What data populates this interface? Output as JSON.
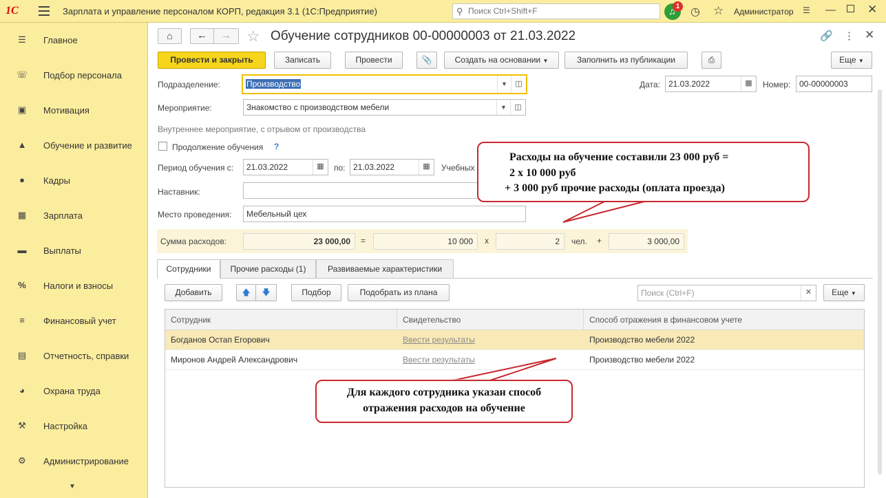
{
  "topbar": {
    "logo": "1С",
    "app_title": "Зарплата и управление персоналом КОРП, редакция 3.1  (1С:Предприятие)",
    "search_placeholder": "Поиск Ctrl+Shift+F",
    "notifications_count": "1",
    "user": "Администратор"
  },
  "sidebar": {
    "items": [
      {
        "label": "Главное",
        "icon": "menu-lines-icon"
      },
      {
        "label": "Подбор персонала",
        "icon": "phone-icon"
      },
      {
        "label": "Мотивация",
        "icon": "gift-icon"
      },
      {
        "label": "Обучение и развитие",
        "icon": "graduation-cap-icon"
      },
      {
        "label": "Кадры",
        "icon": "people-icon"
      },
      {
        "label": "Зарплата",
        "icon": "calculator-icon"
      },
      {
        "label": "Выплаты",
        "icon": "wallet-icon"
      },
      {
        "label": "Налоги и взносы",
        "icon": "percent-icon"
      },
      {
        "label": "Финансовый учет",
        "icon": "ledger-icon"
      },
      {
        "label": "Отчетность, справки",
        "icon": "reports-icon"
      },
      {
        "label": "Охрана труда",
        "icon": "helmet-icon"
      },
      {
        "label": "Настройка",
        "icon": "wrench-icon"
      },
      {
        "label": "Администрирование",
        "icon": "gear-icon"
      }
    ]
  },
  "document": {
    "title": "Обучение сотрудников 00-00000003 от 21.03.2022",
    "toolbar": {
      "post_close": "Провести и закрыть",
      "save": "Записать",
      "post": "Провести",
      "create_based": "Создать на основании",
      "fill_pub": "Заполнить из публикации",
      "more": "Еще"
    },
    "department_label": "Подразделение:",
    "department": "Производство",
    "event_label": "Мероприятие:",
    "event": "Знакомство с производством мебели",
    "event_note": "Внутреннее мероприятие, с отрывом от производства",
    "date_label": "Дата:",
    "date": "21.03.2022",
    "number_label": "Номер:",
    "number": "00-00000003",
    "continue_label": "Продолжение обучения",
    "help": "?",
    "period_label": "Период обучения с:",
    "period_from": "21.03.2022",
    "period_to_label": "по:",
    "period_to": "21.03.2022",
    "study_label": "Учебных",
    "mentor_label": "Наставник:",
    "mentor": "",
    "place_label": "Место проведения:",
    "place": "Мебельный цех",
    "sum_label": "Сумма расходов:",
    "sum_total": "23 000,00",
    "eq": "=",
    "per_person": "10 000",
    "times": "x",
    "persons": "2",
    "persons_unit": "чел.",
    "plus": "+",
    "other": "3 000,00"
  },
  "tabs": [
    {
      "label": "Сотрудники"
    },
    {
      "label": "Прочие расходы (1)"
    },
    {
      "label": "Развиваемые характеристики"
    }
  ],
  "table_toolbar": {
    "add": "Добавить",
    "select": "Подбор",
    "select_plan": "Подобрать из плана",
    "search_placeholder": "Поиск (Ctrl+F)",
    "more": "Еще"
  },
  "table": {
    "columns": [
      "Сотрудник",
      "Свидетельство",
      "Способ отражения в финансовом учете"
    ],
    "rows": [
      {
        "employee": "Богданов Остап Егорович",
        "certificate": "Ввести результаты",
        "method": "Производство мебели 2022"
      },
      {
        "employee": "Миронов Андрей Александрович",
        "certificate": "Ввести результаты",
        "method": "Производство мебели 2022"
      }
    ]
  },
  "callouts": {
    "top": [
      "Расходы на обучение составили 23 000 руб =",
      "2 х 10 000 руб",
      "+ 3 000 руб прочие расходы (оплата проезда)"
    ],
    "bottom": [
      "Для каждого сотрудника указан способ",
      "отражения расходов на обучение"
    ]
  },
  "colors": {
    "accent_yellow": "#fbed9e",
    "primary_button": "#f6d51c",
    "callout_border": "#c8282d",
    "selected_row": "#f9e9b7"
  }
}
